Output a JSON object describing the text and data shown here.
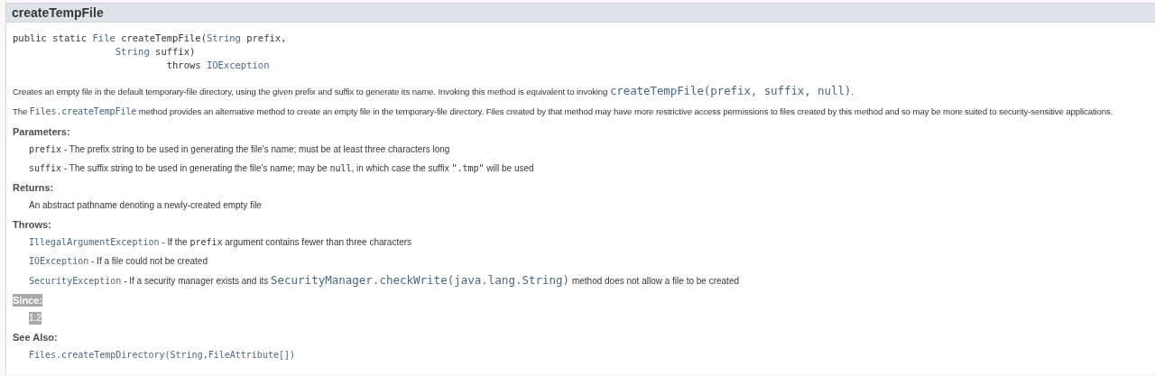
{
  "title": "createTempFile",
  "signature": [
    {
      "kind": "text",
      "text": "public static "
    },
    {
      "kind": "link",
      "text": "File"
    },
    {
      "kind": "text",
      "text": " createTempFile("
    },
    {
      "kind": "link",
      "text": "String"
    },
    {
      "kind": "text",
      "text": " prefix,\n                  "
    },
    {
      "kind": "link",
      "text": "String"
    },
    {
      "kind": "text",
      "text": " suffix)\n                           throws "
    },
    {
      "kind": "link",
      "text": "IOException"
    }
  ],
  "description": [
    [
      {
        "kind": "text",
        "text": "Creates an empty file in the default temporary-file directory, using the given prefix and suffix to generate its name. Invoking this method is equivalent to invoking "
      },
      {
        "kind": "biglink",
        "text": "createTempFile(prefix, suffix, null)"
      },
      {
        "kind": "text",
        "text": "."
      }
    ],
    [
      {
        "kind": "text",
        "text": "The "
      },
      {
        "kind": "link",
        "text": "Files.createTempFile"
      },
      {
        "kind": "text",
        "text": " method provides an alternative method to create an empty file in the temporary-file directory. Files created by that method may have more restrictive access permissions to files created by this method and so may be more suited to security-sensitive applications."
      }
    ]
  ],
  "sections": [
    {
      "heading": "Parameters:",
      "highlighted": false,
      "items": [
        [
          {
            "kind": "code",
            "text": "prefix"
          },
          {
            "kind": "text",
            "text": " - The prefix string to be used in generating the file's name; must be at least three characters long"
          }
        ],
        [
          {
            "kind": "code",
            "text": "suffix"
          },
          {
            "kind": "text",
            "text": " - The suffix string to be used in generating the file's name; may be "
          },
          {
            "kind": "code",
            "text": "null"
          },
          {
            "kind": "text",
            "text": ", in which case the suffix "
          },
          {
            "kind": "code",
            "text": "\".tmp\""
          },
          {
            "kind": "text",
            "text": " will be used"
          }
        ]
      ]
    },
    {
      "heading": "Returns:",
      "highlighted": false,
      "items": [
        [
          {
            "kind": "text",
            "text": "An abstract pathname denoting a newly-created empty file"
          }
        ]
      ]
    },
    {
      "heading": "Throws:",
      "highlighted": false,
      "items": [
        [
          {
            "kind": "link",
            "text": "IllegalArgumentException"
          },
          {
            "kind": "text",
            "text": " - If the "
          },
          {
            "kind": "code",
            "text": "prefix"
          },
          {
            "kind": "text",
            "text": " argument contains fewer than three characters"
          }
        ],
        [
          {
            "kind": "link",
            "text": "IOException"
          },
          {
            "kind": "text",
            "text": " - If a file could not be created"
          }
        ],
        [
          {
            "kind": "link",
            "text": "SecurityException"
          },
          {
            "kind": "text",
            "text": " - If a security manager exists and its "
          },
          {
            "kind": "biglink",
            "text": "SecurityManager.checkWrite(java.lang.String)"
          },
          {
            "kind": "text",
            "text": " method does not allow a file to be created"
          }
        ]
      ]
    },
    {
      "heading": "Since:",
      "highlighted": true,
      "items": [
        [
          {
            "kind": "text",
            "text": "1.2",
            "highlighted": true
          }
        ]
      ]
    },
    {
      "heading": "See Also:",
      "highlighted": false,
      "items": [
        [
          {
            "kind": "link",
            "text": "Files.createTempDirectory(String,FileAttribute[])"
          }
        ]
      ]
    }
  ]
}
